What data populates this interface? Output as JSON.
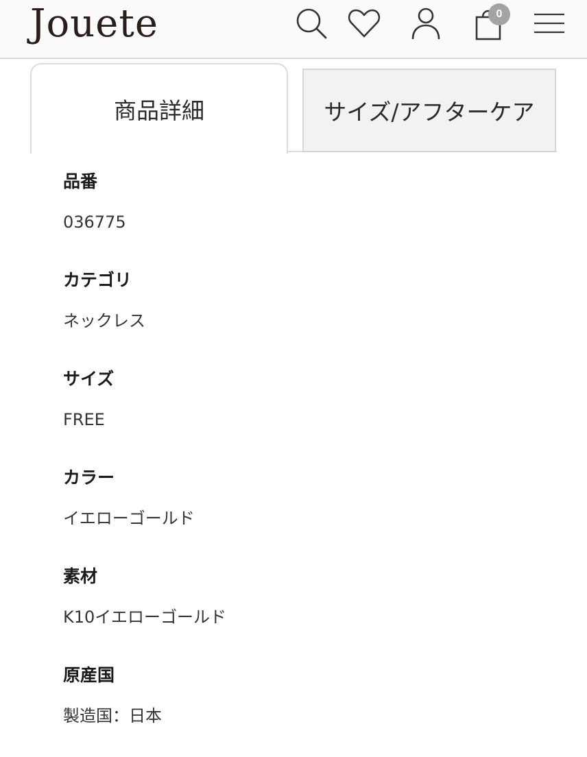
{
  "header": {
    "logo": "Jouete",
    "cart_count": "0",
    "icons": {
      "search": "search-icon",
      "wishlist": "heart-icon",
      "account": "user-icon",
      "cart": "shopping-bag-icon",
      "menu": "hamburger-menu-icon"
    }
  },
  "tabs": [
    {
      "label": "商品詳細",
      "active": true
    },
    {
      "label": "サイズ/アフターケア",
      "active": false
    }
  ],
  "details": [
    {
      "label": "品番",
      "value": "036775"
    },
    {
      "label": "カテゴリ",
      "value": "ネックレス"
    },
    {
      "label": "サイズ",
      "value": "FREE"
    },
    {
      "label": "カラー",
      "value": "イエローゴールド"
    },
    {
      "label": "素材",
      "value": "K10イエローゴールド"
    },
    {
      "label": "原産国",
      "value": "製造国：日本"
    }
  ],
  "colors": {
    "header_bg": "#fafafa",
    "logo": "#2a1d1a",
    "badge": "#a3a3a3",
    "tab_inactive_bg": "#f2f2f2",
    "border": "#dcdcdc"
  }
}
